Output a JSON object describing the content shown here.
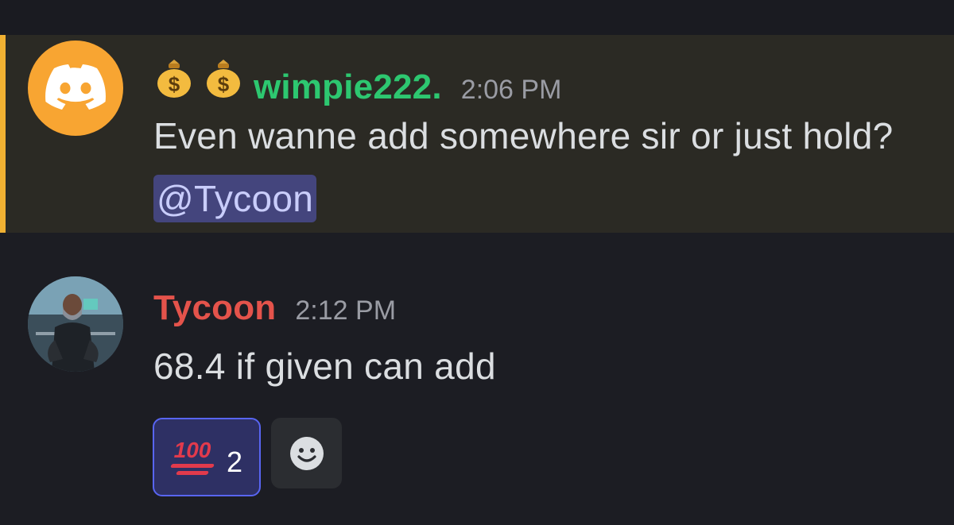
{
  "messages": [
    {
      "author_prefix_icons": [
        "money-bag-icon",
        "money-bag-icon"
      ],
      "author": "wimpie222.",
      "author_color": "#2dc770",
      "timestamp": "2:06 PM",
      "avatar": "discord-logo-icon",
      "avatar_color": "#f8a532",
      "text": "Even wanne add somewhere sir or just hold?",
      "mention": "@Tycoon",
      "highlighted": true,
      "highlight_bar_color": "#f0b132"
    },
    {
      "author": "Tycoon",
      "author_color": "#e4534b",
      "timestamp": "2:12 PM",
      "avatar": "user-photo-avatar",
      "text": "68.4 if given can add",
      "reactions": [
        {
          "emoji": "hundred-points-icon",
          "emoji_text": "100",
          "count": "2",
          "active": true
        }
      ],
      "add_reaction_icon": "smiley-face-icon"
    }
  ],
  "colors": {
    "background": "#1c1d23",
    "highlight_background": "#2b2a24",
    "mention_background": "#44457d",
    "reaction_border": "#5865f2"
  }
}
